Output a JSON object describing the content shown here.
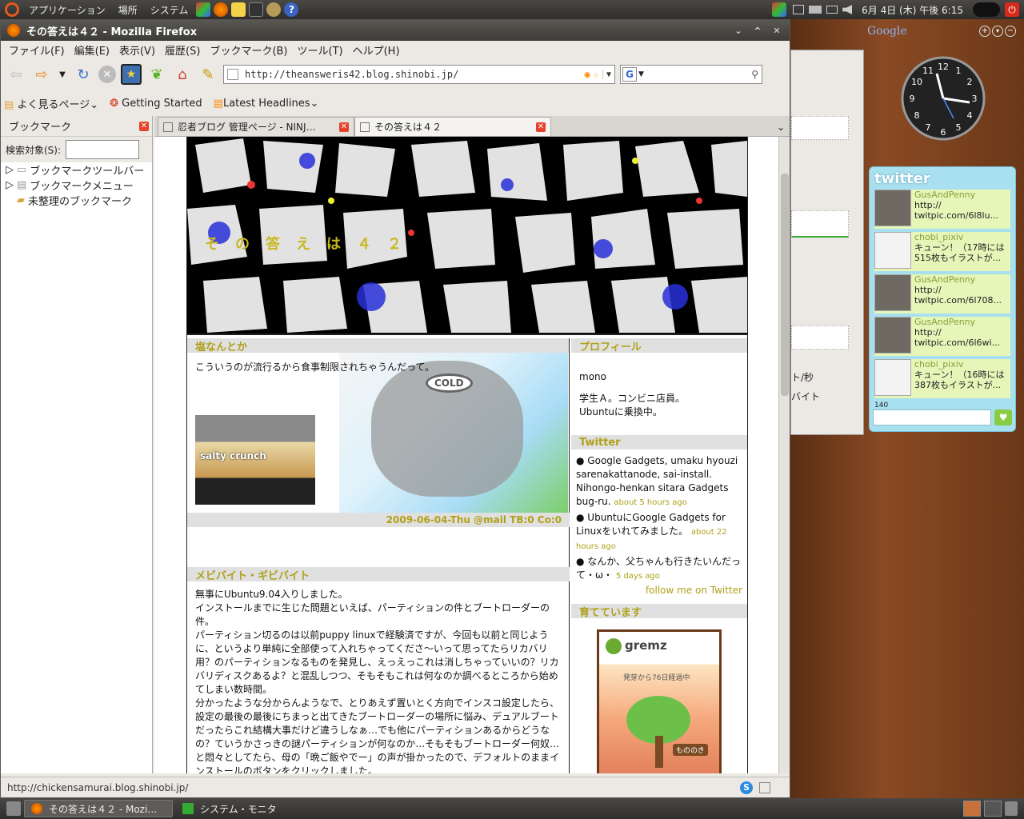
{
  "panel": {
    "menus": [
      "アプリケーション",
      "場所",
      "システム"
    ],
    "clock": "6月 4日 (木) 午後 6:15"
  },
  "window": {
    "title": "その答えは４２ - Mozilla Firefox",
    "menubar": [
      "ファイル(F)",
      "編集(E)",
      "表示(V)",
      "履歴(S)",
      "ブックマーク(B)",
      "ツール(T)",
      "ヘルプ(H)"
    ],
    "url": "http://theansweris42.blog.shinobi.jp/",
    "bookmarks_toolbar": [
      "よく見るページ",
      "Getting Started",
      "Latest Headlines"
    ],
    "status": "http://chickensamurai.blog.shinobi.jp/"
  },
  "sidebar": {
    "title": "ブックマーク",
    "search_label": "検索対象(S):",
    "items": [
      "ブックマークツールバー",
      "ブックマークメニュー",
      "未整理のブックマーク"
    ]
  },
  "tabs": [
    {
      "label": "忍者ブログ 管理ページ - NINJ…"
    },
    {
      "label": "その答えは４２"
    }
  ],
  "blog": {
    "title": "その答えは４２",
    "post1": {
      "title": "塩なんとか",
      "body": "こういうのが流行るから食事制限されちゃうんだって。",
      "footer": "2009-06-04-Thu  @mail  TB:0  Co:0",
      "image_text": "COLD",
      "photo_text": "salty crunch"
    },
    "post2": {
      "title": "メビバイト・ギビバイト",
      "lines": [
        "無事にUbuntu9.04入りしました。",
        "インストールまでに生じた問題といえば、パーティションの件とブートローダーの件。",
        "パーティション切るのは以前puppy linuxで経験済ですが、今回も以前と同じように、というより単純に全部使って入れちゃってくださ〜いって思ってたらリカバリ用？のパーティションなるものを発見し、えっえっこれは消しちゃっていいの？リカバリディスクあるよ？と混乱しつつ、そもそもこれは何なのか調べるところから始めてしまい数時間。",
        "分かったような分からんようなで、とりあえず置いとく方向でインスコ設定したら、設定の最後の最後にちまっと出てきたブートローダーの場所に悩み、デュアルブートだったらこれ結構大事だけど違うしなぁ…でも他にパーティションあるからどうなの？ていうかさっきの謎パーティションが何なのか…そもそもブートローダー何奴…と悶々としてたら、母の「晩ご飯やでー」の声が掛かったので、デフォルトのままインストールのボタンをクリックしました。"
      ]
    },
    "profile": {
      "heading": "プロフィール",
      "name": "mono",
      "desc1": "学生Ａ。コンビニ店員。",
      "desc2": "Ubuntuに乗換中。"
    },
    "twitter": {
      "heading": "Twitter",
      "items": [
        {
          "text": "Google Gadgets, umaku hyouzi sarenakattanode, sai-install. Nihongo-henkan sitara Gadgets bug-ru.",
          "time": "about 5 hours ago"
        },
        {
          "text": "UbuntuにGoogle Gadgets for Linuxをいれてみました。",
          "time": "about 22 hours ago"
        },
        {
          "text": "なんか、父ちゃんも行きたいんだって・ω・",
          "time": "5 days ago"
        }
      ],
      "follow": "follow me on Twitter"
    },
    "grow": {
      "heading": "育てています",
      "brand": "gremz",
      "days": "発芽から76日経過中",
      "tree": "もののき"
    }
  },
  "taskbar": [
    {
      "label": "その答えは４２ - Mozi…"
    },
    {
      "label": "システム・モニタ"
    }
  ],
  "sysmon_fragments": [
    "ト/秒",
    "バイト"
  ],
  "gadgets": {
    "google_label": "Google",
    "twitter_title": "twitter",
    "counter": "140",
    "tweets": [
      {
        "user": "GusAndPenny",
        "text": "http://\ntwitpic.com/6l8lu..."
      },
      {
        "user": "chobi_pixiv",
        "text": "キューン！（17時には515枚もイラストが..."
      },
      {
        "user": "GusAndPenny",
        "text": "http://\ntwitpic.com/6l708..."
      },
      {
        "user": "GusAndPenny",
        "text": "http://\ntwitpic.com/6l6wi..."
      },
      {
        "user": "chobi_pixiv",
        "text": "キューン！（16時には387枚もイラストが..."
      }
    ]
  }
}
